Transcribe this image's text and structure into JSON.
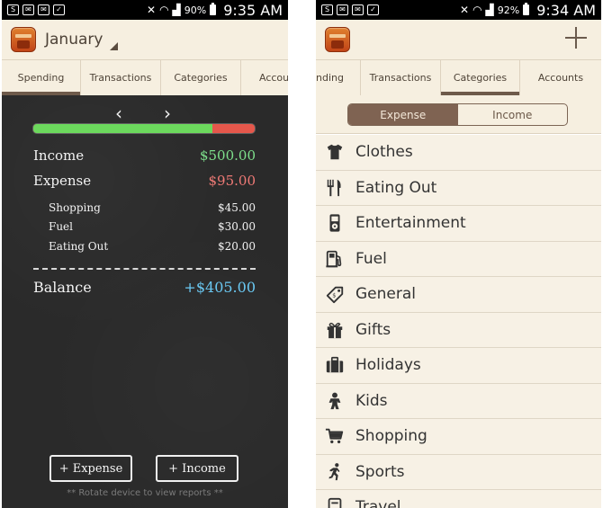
{
  "colors": {
    "income": "#7ee08c",
    "expense": "#f07a76",
    "balance": "#6ac8f2",
    "accent": "#7f6352"
  },
  "left": {
    "status": {
      "battery": "90%",
      "time": "9:35 AM"
    },
    "header": {
      "month": "January"
    },
    "tabs": [
      {
        "label": "Spending",
        "active": true
      },
      {
        "label": "Transactions"
      },
      {
        "label": "Categories"
      },
      {
        "label": "Accou"
      }
    ],
    "nav": {
      "prev": "‹",
      "next": "›"
    },
    "progress": {
      "expense_fraction": 0.19
    },
    "income": {
      "label": "Income",
      "value": "$500.00"
    },
    "expense": {
      "label": "Expense",
      "value": "$95.00"
    },
    "breakdown": [
      {
        "label": "Shopping",
        "value": "$45.00"
      },
      {
        "label": "Fuel",
        "value": "$30.00"
      },
      {
        "label": "Eating Out",
        "value": "$20.00"
      }
    ],
    "balance": {
      "label": "Balance",
      "value": "+$405.00"
    },
    "buttons": {
      "add_expense": "+ Expense",
      "add_income": "+ Income"
    },
    "hint": "** Rotate device to view reports **"
  },
  "right": {
    "status": {
      "battery": "92%",
      "time": "9:34 AM"
    },
    "tabs": [
      {
        "label": "nding"
      },
      {
        "label": "Transactions"
      },
      {
        "label": "Categories",
        "active": true
      },
      {
        "label": "Accounts"
      }
    ],
    "segment": {
      "expense": "Expense",
      "income": "Income"
    },
    "categories": [
      {
        "label": "Clothes",
        "icon": "shirt-icon"
      },
      {
        "label": "Eating Out",
        "icon": "fork-knife-icon"
      },
      {
        "label": "Entertainment",
        "icon": "ipod-icon"
      },
      {
        "label": "Fuel",
        "icon": "fuel-pump-icon"
      },
      {
        "label": "General",
        "icon": "price-tag-icon"
      },
      {
        "label": "Gifts",
        "icon": "gift-icon"
      },
      {
        "label": "Holidays",
        "icon": "suitcase-icon"
      },
      {
        "label": "Kids",
        "icon": "child-icon"
      },
      {
        "label": "Shopping",
        "icon": "shopping-cart-icon"
      },
      {
        "label": "Sports",
        "icon": "runner-icon"
      },
      {
        "label": "Travel",
        "icon": "luggage-icon"
      }
    ]
  }
}
